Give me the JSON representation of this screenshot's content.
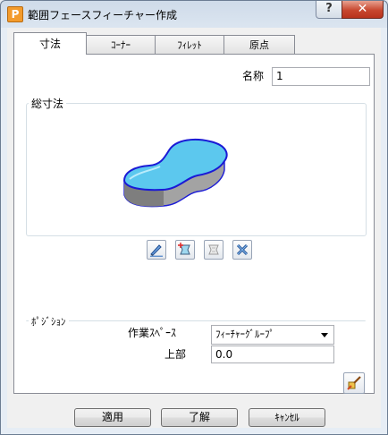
{
  "window": {
    "title": "範囲フェースフィーチャー作成",
    "app_icon": "P",
    "help_label": "?",
    "close_label": "✕"
  },
  "tabs": [
    {
      "label": "寸法"
    },
    {
      "label": "ｺｰﾅｰ"
    },
    {
      "label": "ﾌｨﾚｯﾄ"
    },
    {
      "label": "原点"
    }
  ],
  "name_row": {
    "label": "名称",
    "value": "1"
  },
  "dimensions_group": {
    "title": "総寸法"
  },
  "toolbar_icons": [
    "edit-pencil-icon",
    "vertex-select-icon",
    "shape-outline-icon",
    "delete-x-icon"
  ],
  "position_group": {
    "title": "ﾎﾟｼﾞｼｮﾝ",
    "workspace_label": "作業ｽﾍﾟｰｽ",
    "workspace_value": "ﾌｨｰﾁｬｰｸﾞﾙｰﾌﾟ",
    "top_label": "上部",
    "top_value": "0.0"
  },
  "buttons": {
    "apply": "適用",
    "ok": "了解",
    "cancel": "ｷｬﾝｾﾙ"
  },
  "colors": {
    "shape_fill": "#5cc8ee",
    "shape_outline": "#1a1ad6",
    "shape_side": "#9a9a9a"
  }
}
